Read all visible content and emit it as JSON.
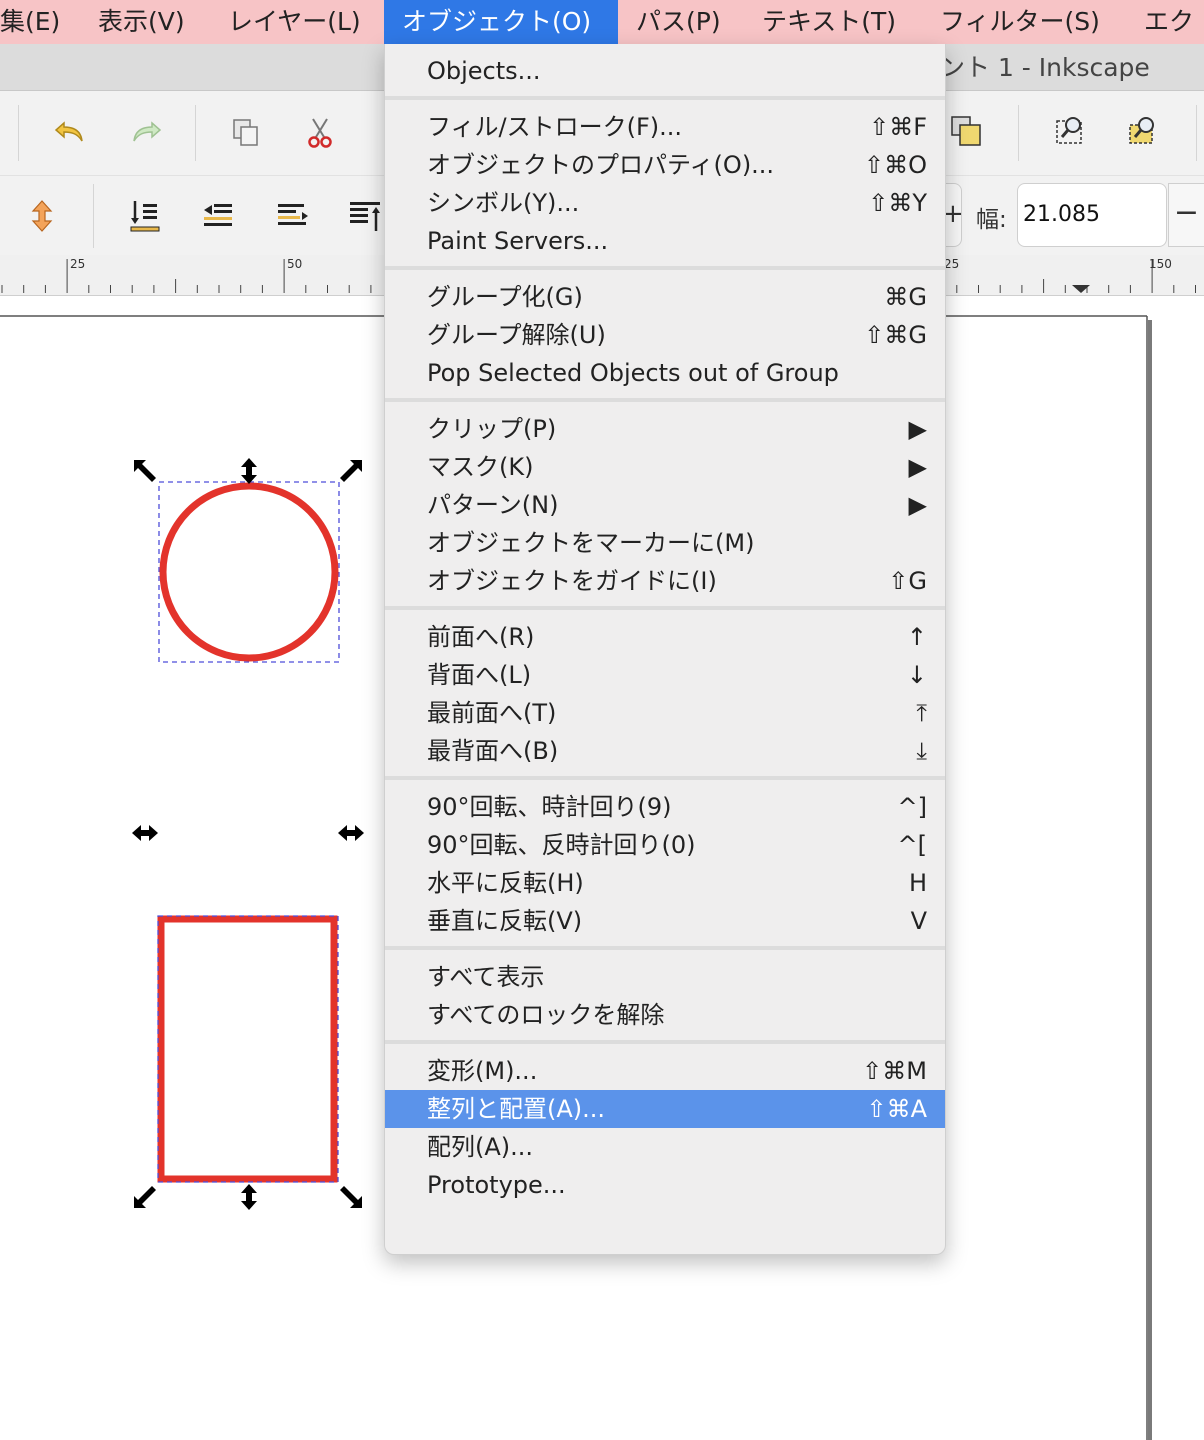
{
  "menubar": {
    "items": [
      "集(E)",
      "表示(V)",
      "レイヤー(L)",
      "オブジェクト(O)",
      "パス(P)",
      "テキスト(T)",
      "フィルター(S)",
      "エク"
    ]
  },
  "window": {
    "title": "ント 1 - Inkscape"
  },
  "toolbar": {
    "width_label": "幅:",
    "width_value": "21.085",
    "width_decrement": "−",
    "width_increment": "+"
  },
  "ruler": {
    "labels": [
      "25",
      "50",
      "25",
      "150"
    ]
  },
  "menu": {
    "groups": [
      [
        {
          "label": "Objects...",
          "shortcut": ""
        }
      ],
      [
        {
          "label": "フィル/ストローク(F)...",
          "shortcut": "⇧⌘F"
        },
        {
          "label": "オブジェクトのプロパティ(O)...",
          "shortcut": "⇧⌘O"
        },
        {
          "label": "シンボル(Y)...",
          "shortcut": "⇧⌘Y"
        },
        {
          "label": "Paint Servers...",
          "shortcut": ""
        }
      ],
      [
        {
          "label": "グループ化(G)",
          "shortcut": "⌘G"
        },
        {
          "label": "グループ解除(U)",
          "shortcut": "⇧⌘G"
        },
        {
          "label": "Pop Selected Objects out of Group",
          "shortcut": ""
        }
      ],
      [
        {
          "label": "クリップ(P)",
          "shortcut": "▶"
        },
        {
          "label": "マスク(K)",
          "shortcut": "▶"
        },
        {
          "label": "パターン(N)",
          "shortcut": "▶"
        },
        {
          "label": "オブジェクトをマーカーに(M)",
          "shortcut": ""
        },
        {
          "label": "オブジェクトをガイドに(I)",
          "shortcut": "⇧G"
        }
      ],
      [
        {
          "label": "前面へ(R)",
          "shortcut": "↑"
        },
        {
          "label": "背面へ(L)",
          "shortcut": "↓"
        },
        {
          "label": "最前面へ(T)",
          "shortcut": "⤒"
        },
        {
          "label": "最背面へ(B)",
          "shortcut": "⤓"
        }
      ],
      [
        {
          "label": "90°回転、時計回り(9)",
          "shortcut": "^]"
        },
        {
          "label": "90°回転、反時計回り(0)",
          "shortcut": "^["
        },
        {
          "label": "水平に反転(H)",
          "shortcut": "H"
        },
        {
          "label": "垂直に反転(V)",
          "shortcut": "V"
        }
      ],
      [
        {
          "label": "すべて表示",
          "shortcut": ""
        },
        {
          "label": "すべてのロックを解除",
          "shortcut": ""
        }
      ],
      [
        {
          "label": "変形(M)...",
          "shortcut": "⇧⌘M"
        },
        {
          "label": "整列と配置(A)...",
          "shortcut": "⇧⌘A",
          "highlighted": true
        },
        {
          "label": "配列(A)...",
          "shortcut": ""
        },
        {
          "label": "Prototype...",
          "shortcut": ""
        }
      ]
    ]
  },
  "colors": {
    "menubar_bg": "#f7c4c6",
    "active_menu": "#2f78e6",
    "highlight": "#5b93ea",
    "shape_stroke": "#e3332b",
    "selection_dash": "#4d4dd9"
  }
}
